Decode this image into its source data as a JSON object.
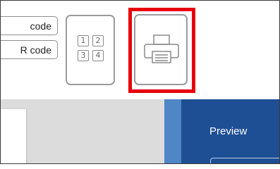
{
  "toolbar": {
    "code_button_1": "code",
    "code_button_2": "R code",
    "grid_cells": [
      "1",
      "2",
      "3",
      "4"
    ]
  },
  "preview_panel": {
    "title": "Preview"
  },
  "colors": {
    "highlight": "#e8000b",
    "panel": "#1e4f95",
    "panel_stripe": "#4f86c6",
    "workspace": "#dcdcdc"
  },
  "icons": {
    "layout_grid": "grid-layout-icon",
    "print": "printer-icon"
  }
}
